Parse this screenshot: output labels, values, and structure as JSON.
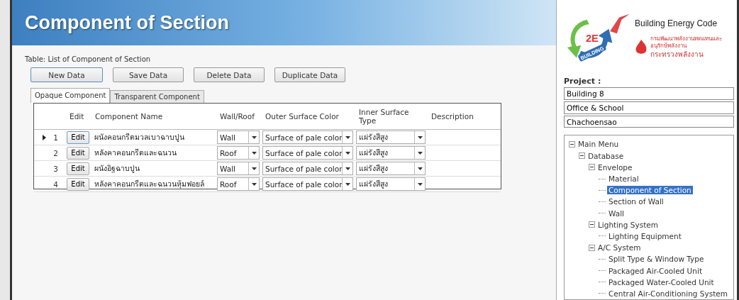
{
  "header": {
    "title": "Component of Section"
  },
  "table_caption": "Table: List of Component of Section",
  "buttons": [
    "New Data",
    "Save Data",
    "Delete Data",
    "Duplicate Data"
  ],
  "tabs": [
    {
      "label": "Opaque Component",
      "selected": true
    },
    {
      "label": "Transparent Component",
      "selected": false
    }
  ],
  "grid": {
    "columns": [
      "Edit",
      "Component Name",
      "Wall/Roof",
      "Outer Surface Color",
      "Inner Surface Type",
      "Description"
    ],
    "rows": [
      {
        "number": "1",
        "selected": true,
        "edit": "Edit",
        "name": "ผนังคอนกรีตมวลเบาฉาบปูน",
        "wall_roof": "Wall",
        "outer": "Surface of pale color",
        "inner": "แผ่รังสีสูง"
      },
      {
        "number": "2",
        "selected": false,
        "edit": "Edit",
        "name": "หลังคาคอนกรีตและฉนวน",
        "wall_roof": "Roof",
        "outer": "Surface of pale color",
        "inner": "แผ่รังสีสูง"
      },
      {
        "number": "3",
        "selected": false,
        "edit": "Edit",
        "name": "ผนังอิฐฉาบปูน",
        "wall_roof": "Wall",
        "outer": "Surface of pale color",
        "inner": "แผ่รังสีสูง"
      },
      {
        "number": "4",
        "selected": false,
        "edit": "Edit",
        "name": "หลังคาคอนกรีตและฉนวนหุ้มฟอยล์",
        "wall_roof": "Roof",
        "outer": "Surface of pale color",
        "inner": "แผ่รังสีสูง"
      }
    ]
  },
  "logo": {
    "badge": "2E",
    "ring_text": "BUILDING",
    "title": "Building Energy Code",
    "agency": "กรมพัฒนาพลังงานทดแทนและอนุรักษ์พลังงาน",
    "ministry": "กระทรวงพลังงาน"
  },
  "project": {
    "label": "Project :",
    "fields": [
      "Building 8",
      "Office & School",
      "Chachoensao"
    ]
  },
  "tree": [
    {
      "label": "Main Menu",
      "expanded": true,
      "selected": false,
      "children": [
        {
          "label": "Database",
          "expanded": true,
          "selected": false,
          "children": [
            {
              "label": "Envelope",
              "expanded": true,
              "selected": false,
              "children": [
                {
                  "label": "Material",
                  "selected": false
                },
                {
                  "label": "Component of Section",
                  "selected": true
                },
                {
                  "label": "Section of Wall",
                  "selected": false
                },
                {
                  "label": "Wall",
                  "selected": false
                }
              ]
            },
            {
              "label": "Lighting System",
              "expanded": true,
              "selected": false,
              "children": [
                {
                  "label": "Lighting Equipment",
                  "selected": false
                }
              ]
            },
            {
              "label": "A/C System",
              "expanded": true,
              "selected": false,
              "children": [
                {
                  "label": "Split Type & Window Type",
                  "selected": false
                },
                {
                  "label": "Packaged Air-Cooled Unit",
                  "selected": false
                },
                {
                  "label": "Packaged Water-Cooled Unit",
                  "selected": false
                },
                {
                  "label": "Central Air-Conditioning System",
                  "selected": false
                }
              ]
            }
          ]
        }
      ]
    }
  ]
}
